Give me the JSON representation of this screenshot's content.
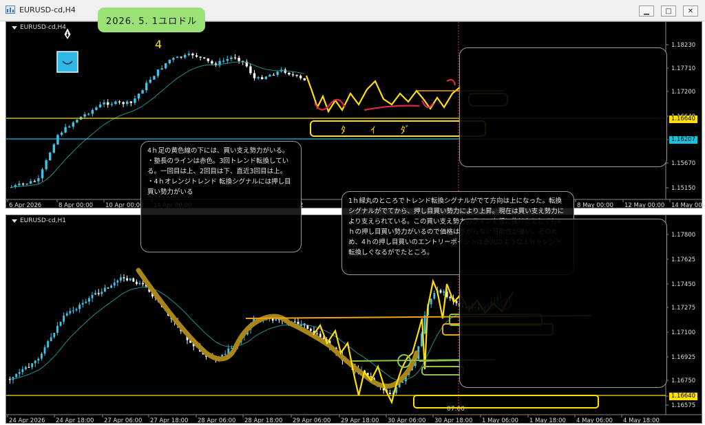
{
  "window": {
    "title": "EURUSD-cd,H4",
    "minimize": "▁",
    "maximize": "□",
    "close": "✕"
  },
  "badge": {
    "text": "2026. 5. 1ユロドル"
  },
  "top_chart": {
    "label": "EURUSD-cd,H4",
    "price_axis": [
      "1.18230",
      "1.17710",
      "1.17200",
      "1.16640",
      "1.16207",
      "1.15670",
      "1.15150"
    ],
    "tag_yellow": "1.16640",
    "tag_cyan": "1.16207",
    "time_axis": [
      "6 Apr 2026",
      "8 Apr 00:00",
      "10 Apr 00:00",
      "14 Apr 00:00",
      "2",
      "8 May 00:00",
      "12 May 00:00",
      "14 May 00"
    ],
    "annotation_top": "4",
    "annotation_box": "ﾀ ｲ ﾀﾞ"
  },
  "bottom_chart": {
    "label": "EURUSD-cd,H1",
    "price_axis": [
      "1.17800",
      "1.17625",
      "1.17450",
      "1.17275",
      "1.17100",
      "1.16925",
      "1.16750",
      "1.16640",
      "1.16575"
    ],
    "tag_yellow": "1.16640",
    "time_axis": [
      "24 Apr 2026",
      "24 Apr 18:00",
      "27 Apr 06:00",
      "27 Apr 18:00",
      "28 Apr 06:00",
      "28 Apr 18:00",
      "29 Apr 06:00",
      "29 Apr 18:00",
      "30 Apr 06:00",
      "30 Apr 18:00",
      "1 May 06:00",
      "1 May 18:00",
      "4 May 06:00",
      "4 May 18:00"
    ],
    "marker": "07:00"
  },
  "bubble1": {
    "lines": [
      "4ｈ足の黄色線の下には、買い支え勢力がいる。",
      "・塾長のラインは赤色。3回トレンド転換している。一回目は上、2回目は下、直近3回目は上。",
      "・4ｈオレンジトレンド 転換シグナルには押し目買い勢力がいる"
    ]
  },
  "bubble2": {
    "text": "1ｈ緑丸のところでトレンド転換シグナルがでて方向は上になった。転換シグナルがでてから、押し目買い勢力により上昇。現在は買い支え勢力により支えられている。この買い支え勢力のラインを仮に抜けたとしても4ｈの押し目買い勢力がいるので価格は下がらない可能性が強い。そのため、4ｈの押し目買いのエントリーポイントは赤丸のような１ｈトレンド転換しぐなるがでたところ。"
  },
  "colors": {
    "bull": "#3fc4e8",
    "bear": "#ffffff",
    "ma": "#1f8f8f",
    "yellow": "#ffe100",
    "cyan": "#19c2dc",
    "orange": "#f4a21a",
    "red": "#e0244f",
    "green": "#8bc34a",
    "olive": "#a8861a"
  }
}
